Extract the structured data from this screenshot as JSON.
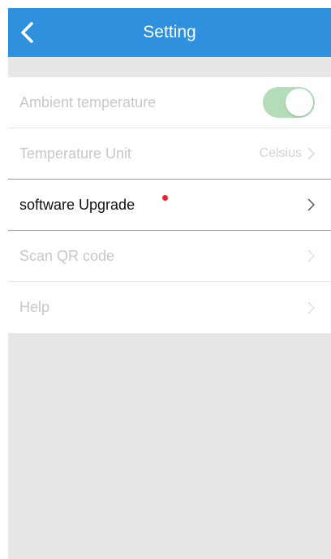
{
  "header": {
    "title": "Setting",
    "back_icon": "chevron-left-icon",
    "background": "#2f90dd"
  },
  "settings": {
    "items": [
      {
        "label": "Ambient temperature",
        "control": "toggle",
        "toggle_on": true,
        "enabled": false
      },
      {
        "label": "Temperature Unit",
        "value": "Celsius",
        "control": "chevron",
        "enabled": false
      },
      {
        "label": "software Upgrade",
        "control": "chevron",
        "enabled": true,
        "badge": "red-dot"
      },
      {
        "label": "Scan QR code",
        "control": "chevron",
        "enabled": false
      },
      {
        "label": "Help",
        "control": "chevron",
        "enabled": false
      }
    ]
  },
  "colors": {
    "accent": "#2f90dd",
    "toggle_on": "#b5dcb8",
    "badge": "#e8232a",
    "disabled_text": "#c8c8c8"
  }
}
